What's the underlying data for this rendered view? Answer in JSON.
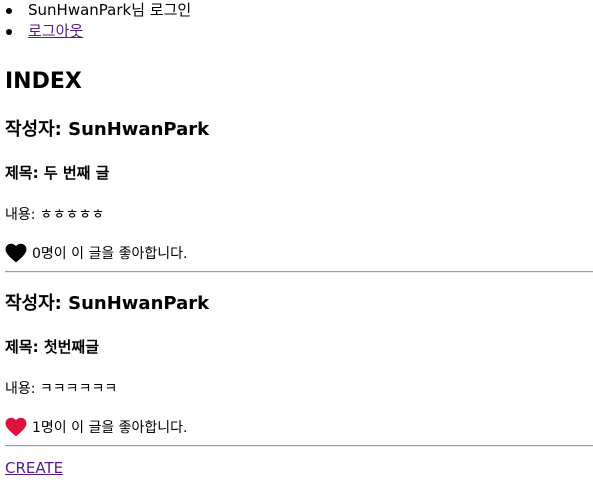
{
  "nav": {
    "greeting": "SunHwanPark님 로그인",
    "logout": "로그아웃"
  },
  "page": {
    "heading": "INDEX",
    "create_link": "CREATE"
  },
  "posts": [
    {
      "author_line": "작성자: SunHwanPark",
      "title_line": "제목: 두 번째 글",
      "content_line": "내용: ㅎㅎㅎㅎㅎ",
      "likes_line": "0명이 이 글을 좋아합니다.",
      "liked": false,
      "heart_color": "#000000"
    },
    {
      "author_line": "작성자: SunHwanPark",
      "title_line": "제목: 첫번째글",
      "content_line": "내용: ㅋㅋㅋㅋㅋㅋ",
      "likes_line": "1명이 이 글을 좋아합니다.",
      "liked": true,
      "heart_color": "#dc143c"
    }
  ],
  "colors": {
    "link": "#551a8b",
    "divider": "#9a9a9a"
  }
}
